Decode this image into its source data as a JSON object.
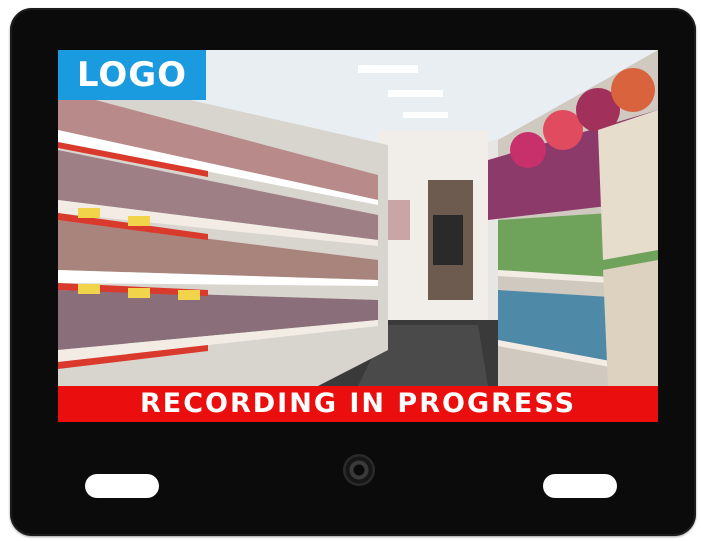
{
  "screen": {
    "logo_text": "LOGO",
    "banner_text": "RECORDING IN PROGRESS"
  },
  "colors": {
    "logo_bg": "#1a9be0",
    "banner_bg": "#ea0e0e",
    "bezel": "#0b0b0b"
  },
  "scene": {
    "subject": "pet-store-aisle-icon"
  }
}
